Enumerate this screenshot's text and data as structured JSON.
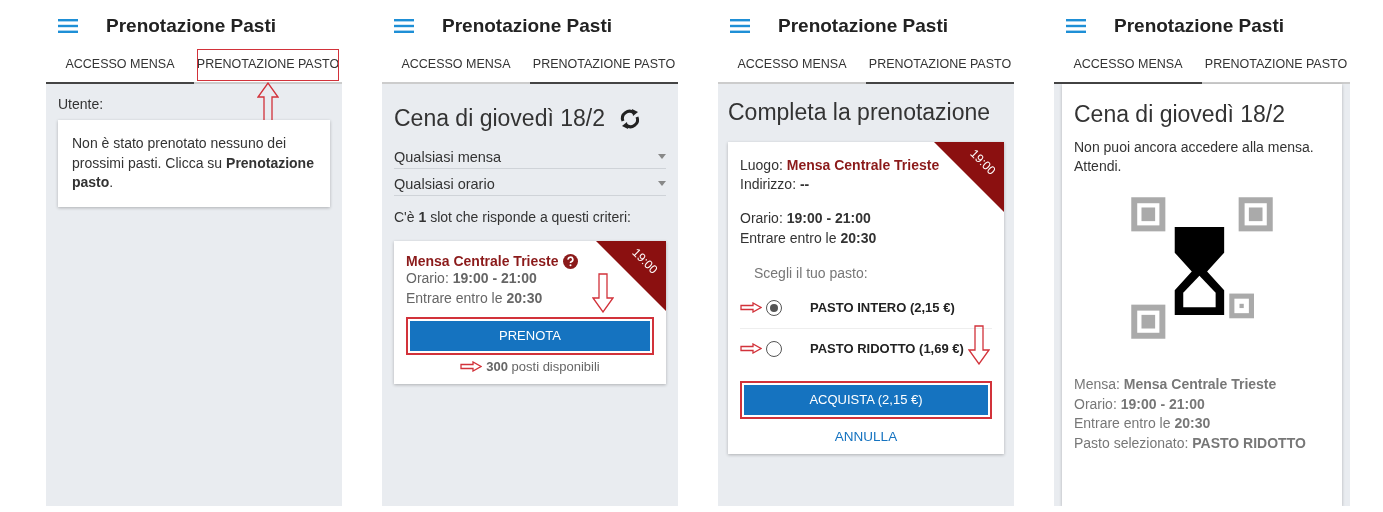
{
  "screens": [
    {
      "title": "Prenotazione Pasti",
      "tabs": [
        {
          "label": "ACCESSO MENSA",
          "selected": true,
          "highlighted": false
        },
        {
          "label": "PRENOTAZIONE PASTO",
          "selected": false,
          "highlighted": true
        }
      ],
      "content": {
        "kind": "notice",
        "label": "Utente:",
        "message": "Non è stato prenotato nessuno dei prossimi pasti. Clicca su **Prenotazione pasto**."
      }
    },
    {
      "title": "Prenotazione Pasti",
      "tabs": [
        {
          "label": "ACCESSO MENSA",
          "selected": false,
          "highlighted": false
        },
        {
          "label": "PRENOTAZIONE PASTO",
          "selected": true,
          "highlighted": false
        }
      ],
      "content": {
        "kind": "slots",
        "heading": "Cena di giovedì 18/2",
        "filters": [
          "Qualsiasi mensa",
          "Qualsiasi orario"
        ],
        "summary": "C'è **1** slot che risponde a questi criteri:",
        "slot": {
          "name": "Mensa Centrale Trieste",
          "ribbon": "19:00",
          "lines": [
            "Orario: **19:00 - 21:00**",
            "Entrare entro le **20:30**"
          ],
          "button": {
            "label": "PRENOTA",
            "highlighted": true
          },
          "availability": {
            "text": "**300** posti disponibili",
            "marked": true
          }
        }
      }
    },
    {
      "title": "Prenotazione Pasti",
      "tabs": [
        {
          "label": "ACCESSO MENSA",
          "selected": false,
          "highlighted": false
        },
        {
          "label": "PRENOTAZIONE PASTO",
          "selected": true,
          "highlighted": false
        }
      ],
      "content": {
        "kind": "checkout",
        "heading": "Completa la prenotazione",
        "place_label": "Luogo:",
        "place": "Mensa Centrale Trieste",
        "ribbon": "19:00",
        "address": "Indirizzo: **--**",
        "lines": [
          "Orario: **19:00 - 21:00**",
          "Entrare entro le **20:30**"
        ],
        "prompt": "Scegli il tuo pasto:",
        "options": [
          {
            "label": "PASTO INTERO (2,15 €)",
            "selected": true,
            "marked": true
          },
          {
            "label": "PASTO RIDOTTO (1,69 €)",
            "selected": false,
            "marked": true
          }
        ],
        "button": {
          "label": "ACQUISTA (2,15 €)",
          "highlighted": true
        },
        "cancel": "ANNULLA"
      }
    },
    {
      "title": "Prenotazione Pasti",
      "tabs": [
        {
          "label": "ACCESSO MENSA",
          "selected": true,
          "highlighted": false
        },
        {
          "label": "PRENOTAZIONE PASTO",
          "selected": false,
          "highlighted": false
        }
      ],
      "content": {
        "kind": "access",
        "heading": "Cena di giovedì 18/2",
        "message": "Non puoi ancora accedere alla mensa. Attendi.",
        "details": [
          "Mensa: **Mensa Centrale Trieste**",
          "Orario: **19:00 - 21:00**",
          "Entrare entro le **20:30**",
          "Pasto selezionato: **PASTO RIDOTTO**"
        ]
      }
    }
  ]
}
